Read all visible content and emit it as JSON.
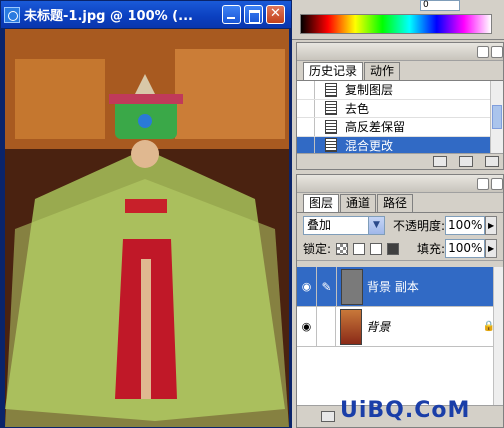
{
  "document_window": {
    "title": "未标题-1.jpg @ 100% (...",
    "minimize_icon": "minimize-icon",
    "maximize_icon": "maximize-icon",
    "close_icon": "close-icon"
  },
  "color_panel": {
    "field_value": "0"
  },
  "history_panel": {
    "tabs": [
      {
        "label": "历史记录",
        "active": true
      },
      {
        "label": "动作",
        "active": false
      }
    ],
    "items": [
      {
        "label": "复制图层",
        "selected": false
      },
      {
        "label": "去色",
        "selected": false
      },
      {
        "label": "高反差保留",
        "selected": false
      },
      {
        "label": "混合更改",
        "selected": true
      }
    ]
  },
  "layers_panel": {
    "tabs": [
      {
        "label": "图层",
        "active": true
      },
      {
        "label": "通道",
        "active": false
      },
      {
        "label": "路径",
        "active": false
      }
    ],
    "blend_mode": "叠加",
    "opacity_label": "不透明度:",
    "opacity_value": "100%",
    "lock_label": "锁定:",
    "fill_label": "填充:",
    "fill_value": "100%",
    "layers": [
      {
        "name": "背景 副本",
        "selected": true,
        "locked": false
      },
      {
        "name": "背景",
        "selected": false,
        "locked": true
      }
    ]
  },
  "watermark": "UiBQ.CoM",
  "colors": {
    "title_bar": "#0b3fbf",
    "selection": "#316ac5",
    "panel_bg": "#d4d0c8"
  }
}
